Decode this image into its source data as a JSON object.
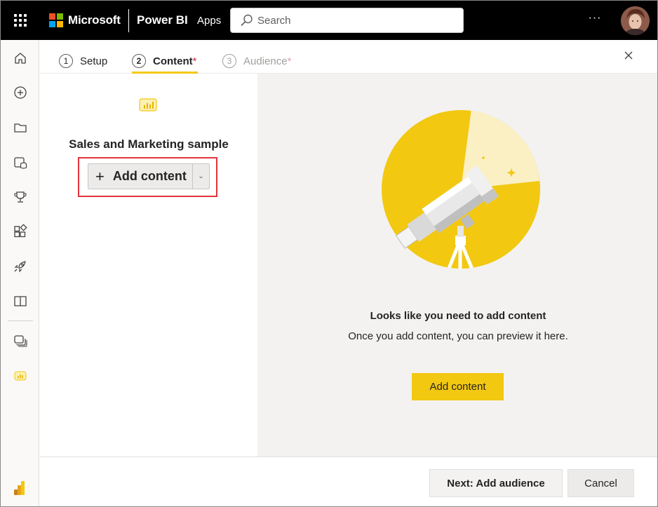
{
  "topbar": {
    "brand": "Microsoft",
    "product": "Power BI",
    "section": "Apps",
    "search_placeholder": "Search",
    "more_label": "···"
  },
  "wizard": {
    "steps": [
      {
        "num": "1",
        "label": "Setup",
        "required": ""
      },
      {
        "num": "2",
        "label": "Content",
        "required": "*"
      },
      {
        "num": "3",
        "label": "Audience",
        "required": "*"
      }
    ]
  },
  "content_panel": {
    "app_name": "Sales and Marketing sample",
    "add_content_button": "Add content",
    "add_icon": "+"
  },
  "preview": {
    "title": "Looks like you need to add content",
    "subtitle": "Once you add content, you can preview it here.",
    "button": "Add content"
  },
  "footer": {
    "next_button": "Next: Add audience",
    "cancel_button": "Cancel"
  },
  "colors": {
    "accent_yellow": "#F2C811",
    "highlight_red": "#E0343D",
    "topbar_bg": "#000000"
  },
  "icons": {
    "left_nav": [
      "home-icon",
      "create-icon",
      "browse-icon",
      "data-hub-icon",
      "metrics-icon",
      "apps-icon",
      "deployment-icon",
      "learn-icon",
      "workspaces-icon",
      "current-workspace-icon",
      "powerbi-logo-icon"
    ]
  }
}
